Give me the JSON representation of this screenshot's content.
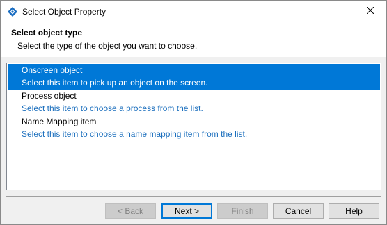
{
  "window": {
    "title": "Select Object Property"
  },
  "header": {
    "title": "Select object type",
    "subtitle": "Select the type of the object you want to choose."
  },
  "list": {
    "items": [
      {
        "name": "Onscreen object",
        "description": "Select this item to pick up an object on the screen.",
        "selected": true
      },
      {
        "name": "Process object",
        "description": "Select this item to choose a process from the list.",
        "selected": false
      },
      {
        "name": "Name Mapping item",
        "description": "Select this item to choose a name mapping item from the list.",
        "selected": false
      }
    ]
  },
  "buttons": {
    "back": {
      "prefix": "< ",
      "mnemonic": "B",
      "rest": "ack",
      "enabled": false
    },
    "next": {
      "mnemonic": "N",
      "rest": "ext >",
      "enabled": true
    },
    "finish": {
      "mnemonic": "F",
      "rest": "inish",
      "enabled": false
    },
    "cancel": {
      "label": "Cancel",
      "enabled": true
    },
    "help": {
      "mnemonic": "H",
      "rest": "elp",
      "enabled": true
    }
  },
  "colors": {
    "selection": "#0078d7",
    "description_text": "#1a6ebd",
    "app_icon": "#1b6ec2"
  },
  "icons": {
    "app": "app-icon",
    "close": "close-icon"
  }
}
